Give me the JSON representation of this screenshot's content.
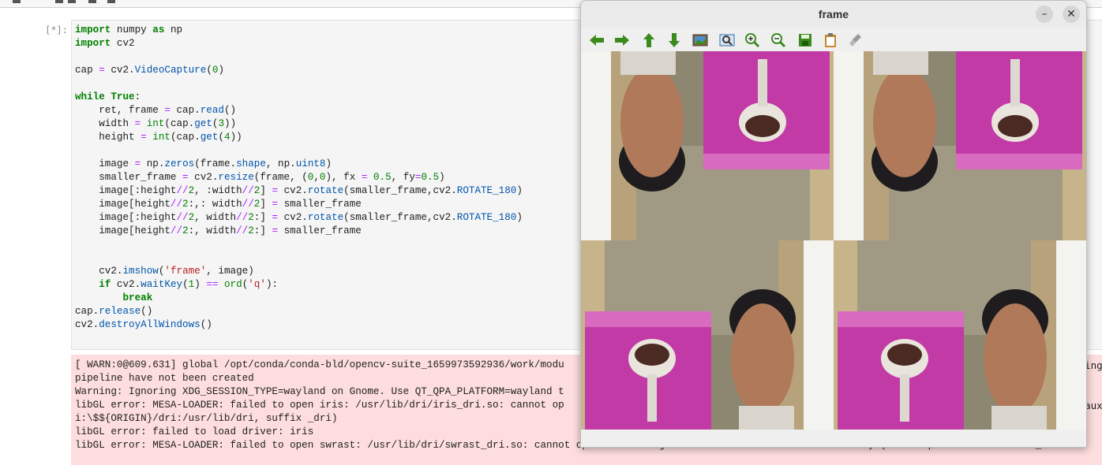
{
  "notebook": {
    "prompt": "[*]:",
    "code_lines": [
      "import numpy as np",
      "import cv2",
      "",
      "cap = cv2.VideoCapture(0)",
      "",
      "while True:",
      "    ret, frame = cap.read()",
      "    width = int(cap.get(3))",
      "    height = int(cap.get(4))",
      "",
      "    image = np.zeros(frame.shape, np.uint8)",
      "    smaller_frame = cv2.resize(frame, (0,0), fx = 0.5, fy=0.5)",
      "    image[:height//2, :width//2] = cv2.rotate(smaller_frame,cv2.ROTATE_180)",
      "    image[height//2:,: width//2] = smaller_frame",
      "    image[:height//2, width//2:] = cv2.rotate(smaller_frame,cv2.ROTATE_180)",
      "    image[height//2:, width//2:] = smaller_frame",
      "",
      "",
      "    cv2.imshow('frame', image)",
      "    if cv2.waitKey(1) == ord('q'):",
      "        break",
      "cap.release()",
      "cv2.destroyAllWindows()"
    ],
    "output_lines": [
      "[ WARN:0@609.631] global /opt/conda/conda-bld/opencv-suite_1659973592936/work/modu",
      "pipeline have not been created",
      "Warning: Ignoring XDG_SESSION_TYPE=wayland on Gnome. Use QT_QPA_PLATFORM=wayland t",
      "libGL error: MESA-LOADER: failed to open iris: /usr/lib/dri/iris_dri.so: cannot op",
      "i:\\$${ORIGIN}/dri:/usr/lib/dri, suffix _dri)",
      "libGL error: failed to load driver: iris",
      "libGL error: MESA-LOADER: failed to open swrast: /usr/lib/dri/swrast_dri.so: cannot open shared object file: No such file or directory (search paths /usr/lib/x86_64-l"
    ],
    "output_right": {
      "line1_tail": "ing",
      "line4_tail": "aux"
    }
  },
  "window": {
    "title": "frame",
    "minimize_glyph": "–",
    "close_glyph": "✕",
    "toolbar": [
      {
        "name": "pan-left-icon",
        "color": "#3a8a1e"
      },
      {
        "name": "pan-right-icon",
        "color": "#3a8a1e"
      },
      {
        "name": "pan-up-icon",
        "color": "#3a8a1e"
      },
      {
        "name": "pan-down-icon",
        "color": "#3a8a1e"
      },
      {
        "name": "zoom-image-icon",
        "color": "#2b6fb0"
      },
      {
        "name": "zoom-fit-icon",
        "color": "#2b6fb0"
      },
      {
        "name": "zoom-in-icon",
        "color": "#3a8a1e"
      },
      {
        "name": "zoom-out-icon",
        "color": "#3a8a1e"
      },
      {
        "name": "save-icon",
        "color": "#3a8a1e"
      },
      {
        "name": "properties-icon",
        "color": "#b07a1e"
      },
      {
        "name": "clear-icon",
        "color": "#8a8a8a"
      }
    ],
    "frame_image": {
      "quadrants": [
        "top-left-rotated",
        "top-right-rotated",
        "bottom-left",
        "bottom-right"
      ]
    }
  }
}
